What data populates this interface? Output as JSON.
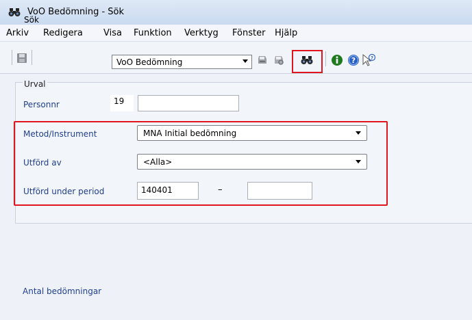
{
  "window": {
    "title": "VoO Bedömning - Sök",
    "app_icon": "binoculars-icon"
  },
  "menu": {
    "items": [
      "Arkiv",
      "Redigera",
      "Visa",
      "Funktion",
      "Verktyg",
      "Fönster",
      "Hjälp"
    ]
  },
  "toolbar": {
    "search_label": "Sök",
    "module_select_value": "VoO Bedömning",
    "icons": [
      "save-icon",
      "print-icon",
      "print-preview-icon",
      "binoculars-search-icon",
      "info-icon",
      "help-icon",
      "context-help-icon"
    ]
  },
  "form": {
    "group_label": "Urval",
    "personnr_label": "Personnr",
    "personnr_prefix": "19",
    "personnr_value": "",
    "method_label": "Metod/Instrument",
    "method_value": "MNA Initial bedömning",
    "performed_by_label": "Utförd av",
    "performed_by_value": "<Alla>",
    "period_label": "Utförd under period",
    "period_from": "140401",
    "period_separator": "–",
    "period_to": ""
  },
  "footer": {
    "count_label": "Antal bedömningar"
  },
  "colors": {
    "highlight": "#e0141f",
    "label_blue": "#1f3f8f"
  }
}
